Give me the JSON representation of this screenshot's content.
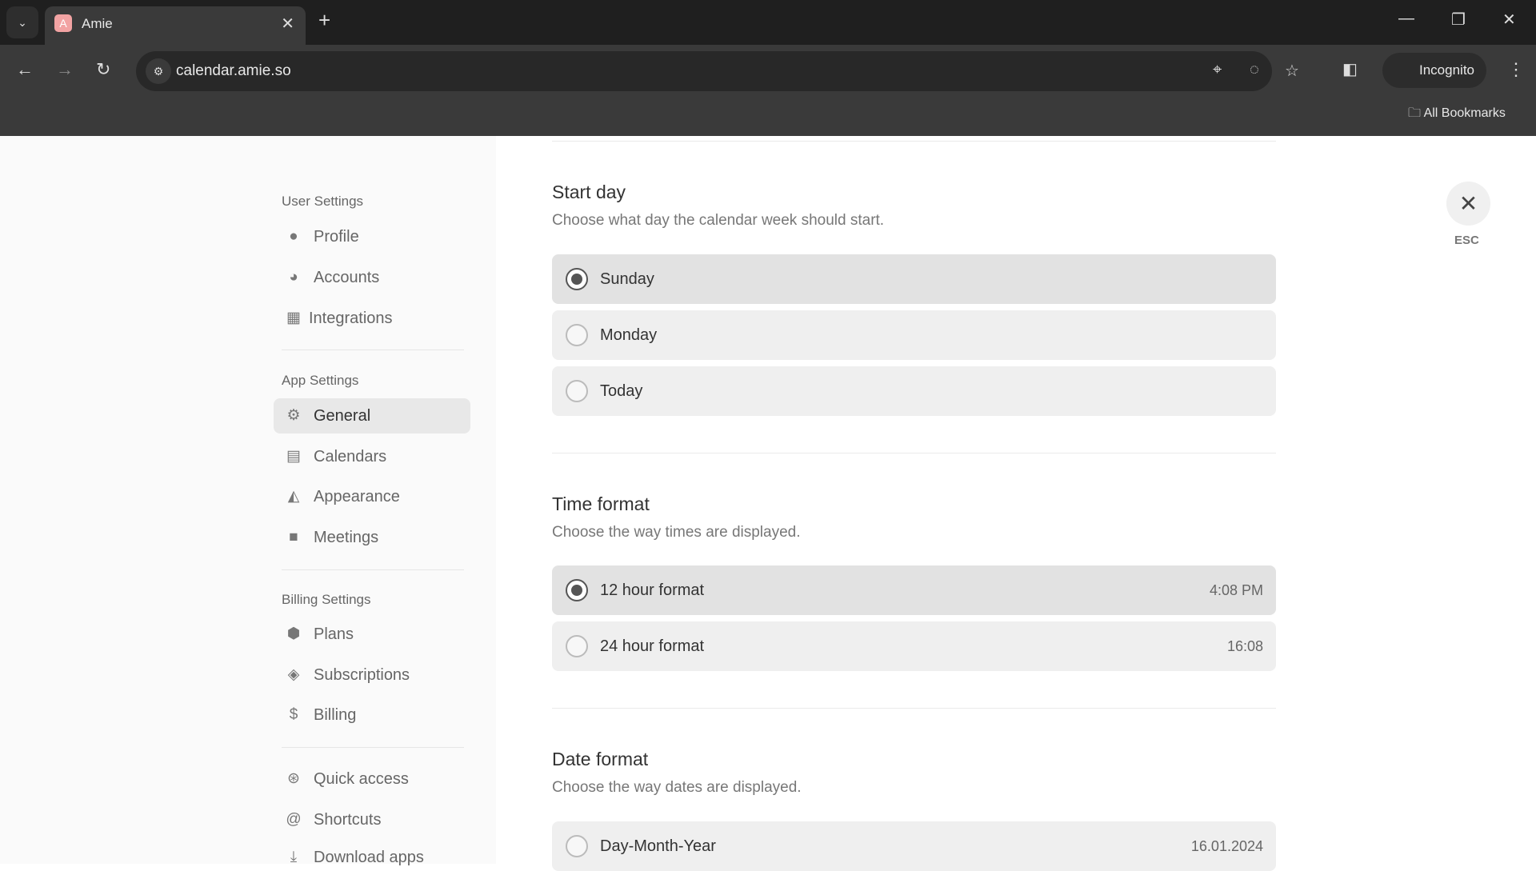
{
  "browser": {
    "tab_title": "Amie",
    "tab_favicon": "A",
    "url": "calendar.amie.so",
    "incognito_label": "Incognito",
    "bookmarks_label": "All Bookmarks"
  },
  "sidebar": {
    "sections": [
      {
        "title": "User Settings",
        "items": [
          {
            "label": "Profile",
            "icon": "user-circle-icon"
          },
          {
            "label": "Accounts",
            "icon": "accounts-icon"
          },
          {
            "label": "Integrations",
            "icon": "grid-icon"
          }
        ]
      },
      {
        "title": "App Settings",
        "items": [
          {
            "label": "General",
            "icon": "gear-icon",
            "active": true
          },
          {
            "label": "Calendars",
            "icon": "calendar-icon"
          },
          {
            "label": "Appearance",
            "icon": "appearance-icon"
          },
          {
            "label": "Meetings",
            "icon": "video-icon"
          }
        ]
      },
      {
        "title": "Billing Settings",
        "items": [
          {
            "label": "Plans",
            "icon": "hexagon-icon"
          },
          {
            "label": "Subscriptions",
            "icon": "box-icon"
          },
          {
            "label": "Billing",
            "icon": "dollar-icon"
          }
        ]
      },
      {
        "title": "",
        "items": [
          {
            "label": "Quick access",
            "icon": "quick-access-icon"
          },
          {
            "label": "Shortcuts",
            "icon": "at-icon"
          },
          {
            "label": "Download apps",
            "icon": "download-icon"
          }
        ]
      }
    ]
  },
  "main": {
    "start_day": {
      "title": "Start day",
      "desc": "Choose what day the calendar week should start.",
      "options": [
        {
          "label": "Sunday",
          "selected": true
        },
        {
          "label": "Monday"
        },
        {
          "label": "Today"
        }
      ]
    },
    "time_format": {
      "title": "Time format",
      "desc": "Choose the way times are displayed.",
      "options": [
        {
          "label": "12 hour format",
          "value": "4:08 PM",
          "selected": true
        },
        {
          "label": "24 hour format",
          "value": "16:08"
        }
      ]
    },
    "date_format": {
      "title": "Date format",
      "desc": "Choose the way dates are displayed.",
      "options": [
        {
          "label": "Day-Month-Year",
          "value": "16.01.2024"
        }
      ]
    }
  },
  "close": {
    "label": "ESC"
  }
}
